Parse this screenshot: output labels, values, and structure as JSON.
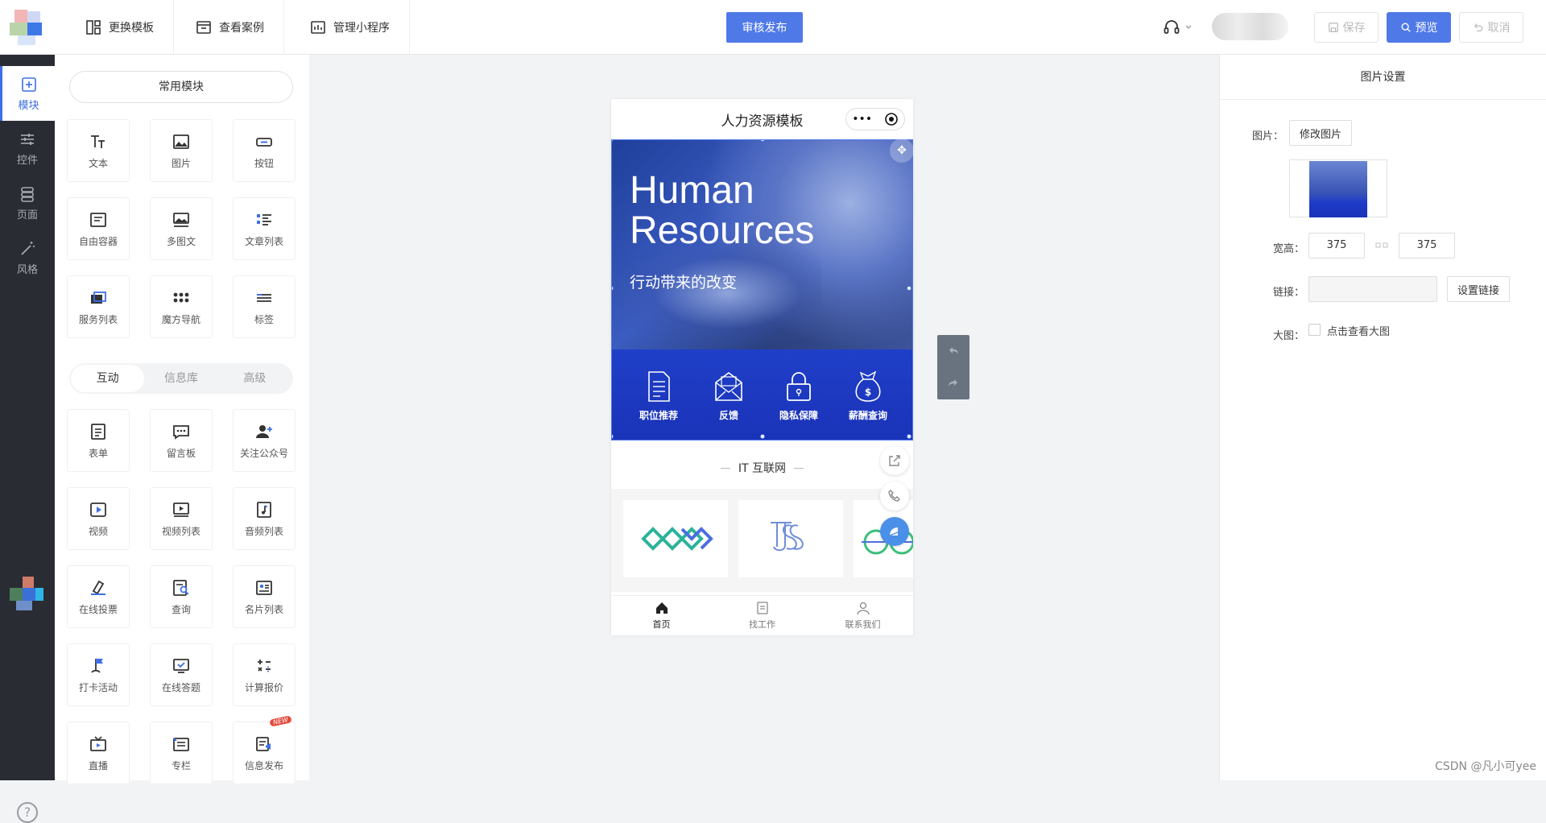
{
  "topbar": {
    "nav": [
      "更换模板",
      "查看案例",
      "管理小程序"
    ],
    "publish": "审核发布",
    "save": "保存",
    "preview": "预览",
    "cancel": "取消"
  },
  "leftnav": {
    "items": [
      "模块",
      "控件",
      "页面",
      "风格"
    ],
    "help": "?"
  },
  "panel": {
    "section_title": "常用模块",
    "common": [
      "文本",
      "图片",
      "按钮",
      "自由容器",
      "多图文",
      "文章列表",
      "服务列表",
      "魔方导航",
      "标签"
    ],
    "tabs": [
      "互动",
      "信息库",
      "高级"
    ],
    "interactive": [
      "表单",
      "留言板",
      "关注公众号",
      "视频",
      "视频列表",
      "音频列表",
      "在线投票",
      "查询",
      "名片列表",
      "打卡活动",
      "在线答题",
      "计算报价",
      "直播",
      "专栏",
      "信息发布"
    ],
    "new_badge": "NEW"
  },
  "phone": {
    "title": "人力资源模板",
    "banner_title_1": "Human",
    "banner_title_2": "Resources",
    "banner_subtitle": "行动带来的改变",
    "banner_icons": [
      "职位推荐",
      "反馈",
      "隐私保障",
      "薪酬查询"
    ],
    "category": "IT 互联网",
    "tabbar": [
      "首页",
      "找工作",
      "联系我们"
    ]
  },
  "rpanel": {
    "title": "图片设置",
    "image_label": "图片：",
    "change_image": "修改图片",
    "size_label": "宽高：",
    "width": "375",
    "height": "375",
    "link_label": "链接：",
    "link_value": "",
    "set_link": "设置链接",
    "bigimg_label": "大图：",
    "bigimg_option": "点击查看大图"
  },
  "watermark": "CSDN @凡小可yee",
  "colors": {
    "accent": "#5079e8",
    "sidebar": "#2a2c33",
    "banner": "#1f3fc8"
  }
}
